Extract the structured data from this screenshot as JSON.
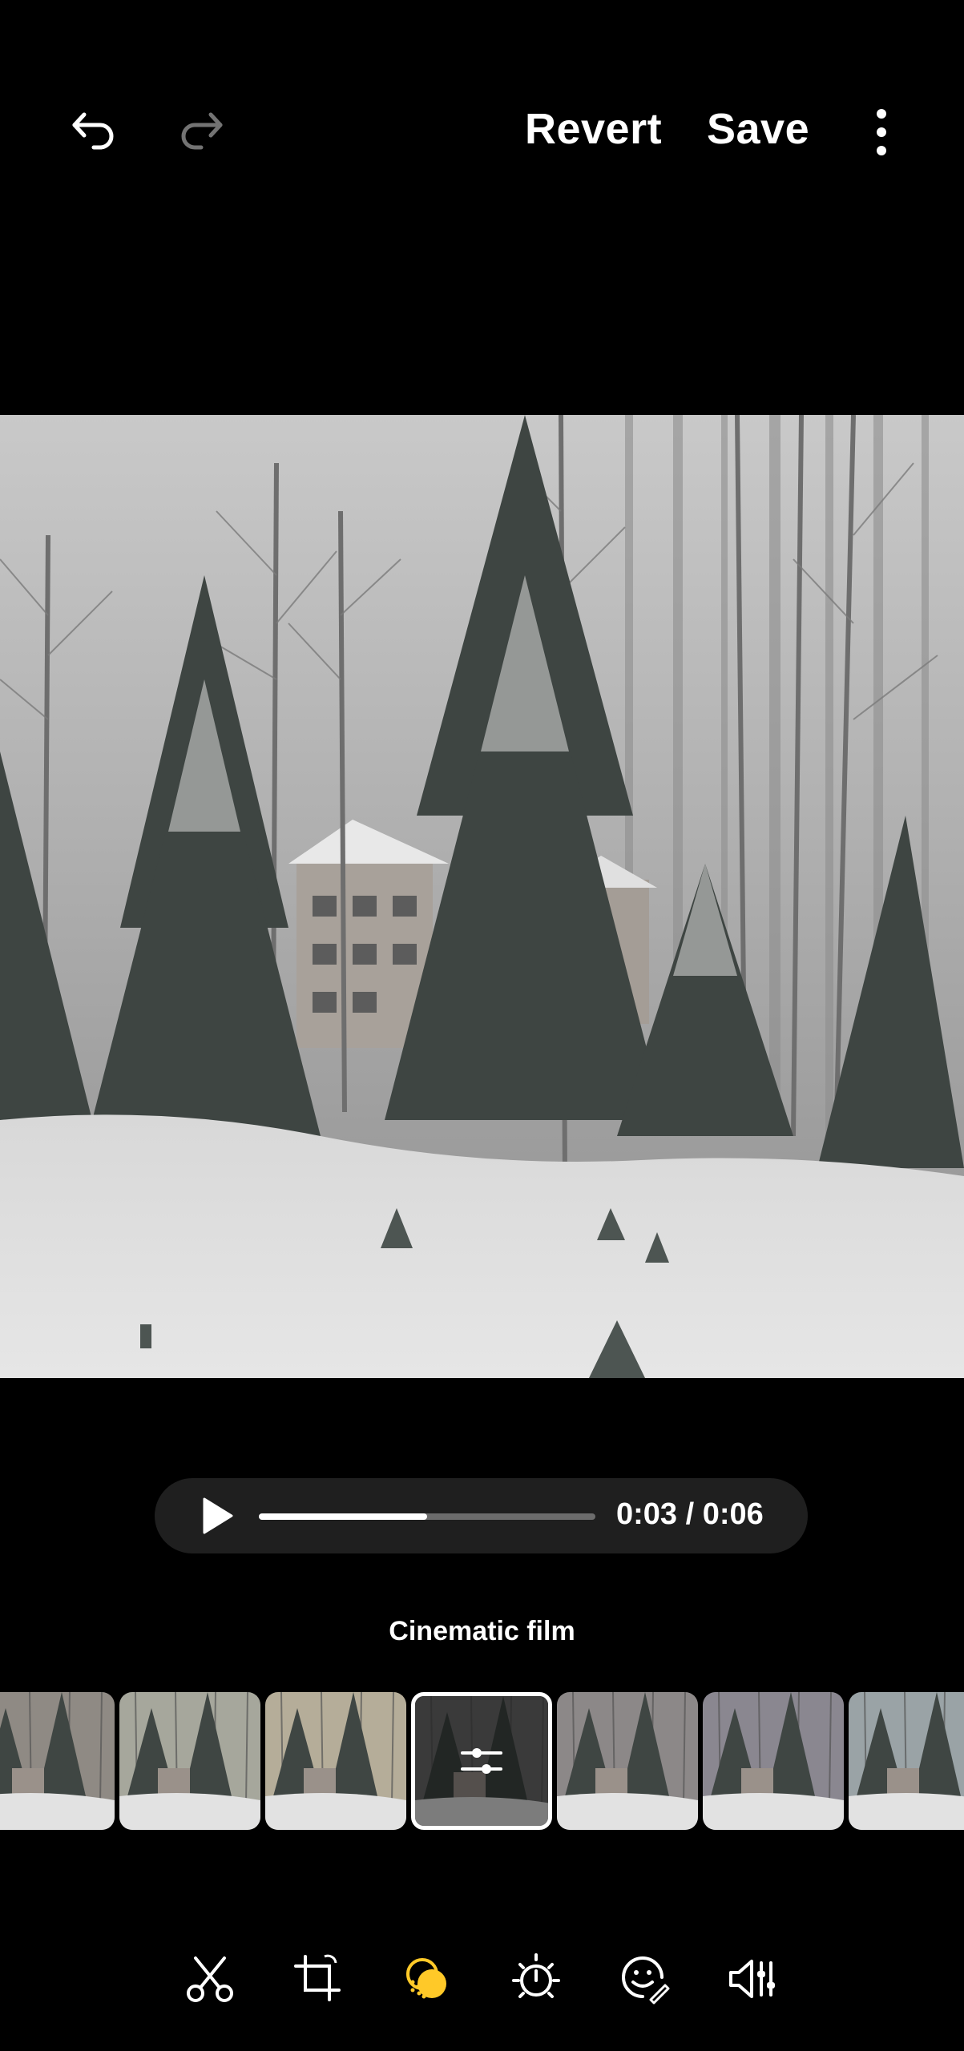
{
  "toolbar_top": {
    "undo_icon": "undo-icon",
    "redo_icon": "redo-icon",
    "revert_label": "Revert",
    "save_label": "Save",
    "more_icon": "more-vertical-icon"
  },
  "player": {
    "play_icon": "play-icon",
    "progress_fraction": 0.5,
    "time_text": "0:03 / 0:06"
  },
  "filter": {
    "current_name": "Cinematic film",
    "thumbnails": [
      {
        "name": "filter-1"
      },
      {
        "name": "filter-2"
      },
      {
        "name": "filter-3"
      },
      {
        "name": "filter-4-selected"
      },
      {
        "name": "filter-5"
      },
      {
        "name": "filter-6"
      },
      {
        "name": "filter-7"
      }
    ],
    "selected_index": 3
  },
  "tools": [
    {
      "icon": "trim-icon"
    },
    {
      "icon": "crop-rotate-icon"
    },
    {
      "icon": "filters-icon"
    },
    {
      "icon": "adjust-brightness-icon"
    },
    {
      "icon": "sticker-emoji-icon"
    },
    {
      "icon": "audio-icon"
    }
  ],
  "colors": {
    "background": "#000000",
    "player_bg": "#1f1f1f",
    "accent_yellow": "#ffc928",
    "redo_disabled": "#7a7a7a"
  }
}
